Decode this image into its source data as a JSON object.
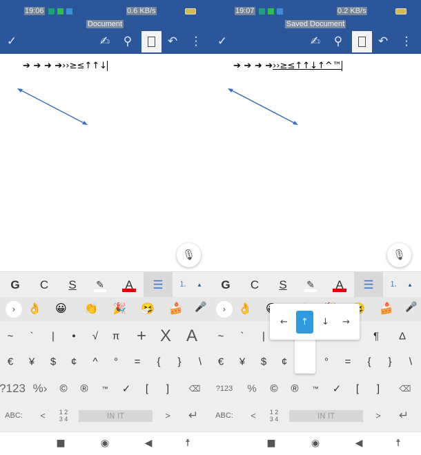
{
  "panels": [
    {
      "status": {
        "time": "19:06",
        "speed": "0.6 KB/s"
      },
      "title": "Document",
      "document_text": "➔ ➔ ➜ ➔",
      "document_text_tail": "››≥≤↑↑↓",
      "keyboard_row1": [
        "~",
        "`",
        "|",
        "•",
        "√",
        "π",
        "+",
        "X",
        "A"
      ],
      "symbol_mode_label": "?123",
      "percent_key": "%›"
    },
    {
      "status": {
        "time": "19:07",
        "speed": "0.2 KB/s"
      },
      "title": "Saved Document",
      "document_text": "➔ ➔ ➜ ➔",
      "document_text_tail": "››≥≤↑↑↓↑^™",
      "keyboard_row1": [
        "~",
        "`",
        "|",
        "",
        "",
        "",
        "×",
        "¶",
        "Δ"
      ],
      "symbol_mode_label": "?123",
      "percent_key": "%",
      "popup": {
        "options": [
          "←",
          "↑",
          "↓",
          "→"
        ],
        "selected": "↑"
      }
    }
  ],
  "format_toolbar": {
    "bold": "G",
    "italic": "C",
    "underline": "S",
    "font_color_label": "A",
    "font_color": "#e00000",
    "highlight_color": "#ffffff"
  },
  "emoji_row": [
    "👌",
    "😀",
    "👏",
    "🎉",
    "🤧",
    "🍰"
  ],
  "keyboard_row2": [
    "€",
    "¥",
    "$",
    "¢",
    "^",
    "°",
    "=",
    "{",
    "}",
    "\\"
  ],
  "keyboard_row3": [
    "©",
    "®",
    "™",
    "✓",
    "[",
    "]"
  ],
  "keyboard_row4": {
    "abc": "ABC:",
    "less": "<",
    "numpad": "1 2\n3 4",
    "space": "IN IT",
    "greater": ">",
    "enter": "↵"
  },
  "colors": {
    "header": "#2b579a",
    "popup_selected": "#2e9be0"
  }
}
